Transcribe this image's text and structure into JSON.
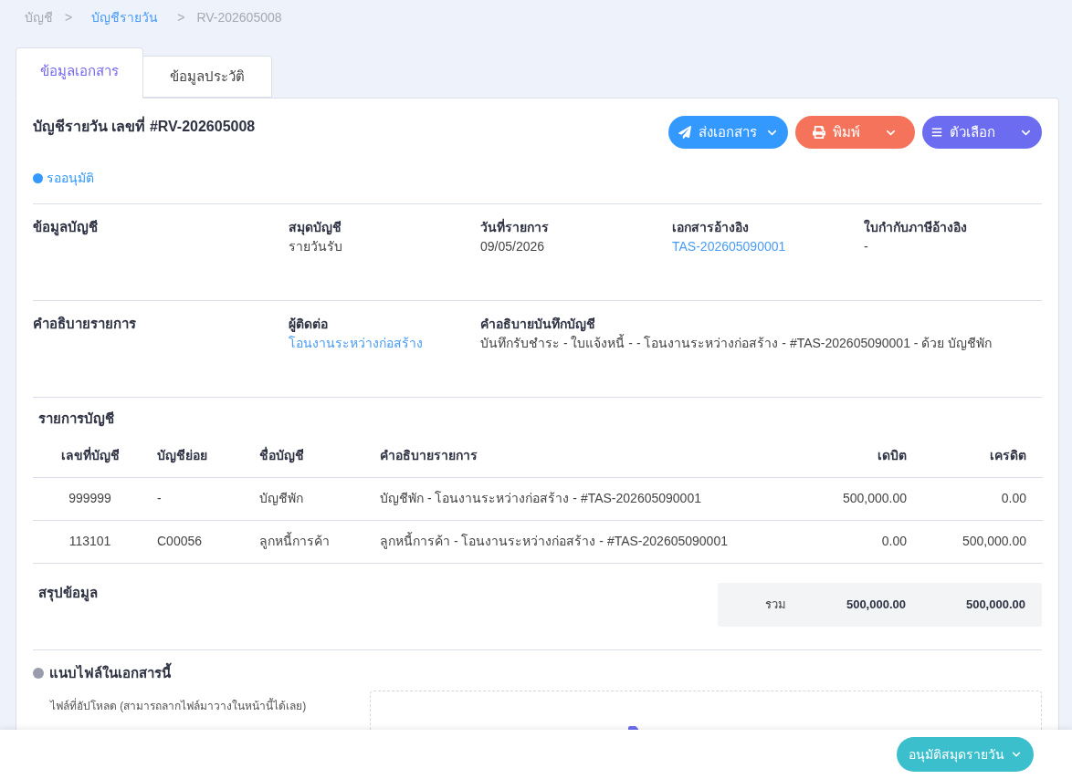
{
  "breadcrumb": [
    {
      "label": "บัญชี",
      "link": false
    },
    {
      "separator": ">",
      "label": "บัญชีรายวัน",
      "link": true
    },
    {
      "separator": ">",
      "label": "RV-202605008",
      "link": false
    }
  ],
  "tabs": [
    {
      "label": "ข้อมูลเอกสาร",
      "selected": true
    },
    {
      "label": "ข้อมูลประวัติ",
      "selected": false
    }
  ],
  "document": {
    "title": "บัญชีรายวัน เลขที่ #RV-202605008",
    "status": "รออนุมัติ"
  },
  "actions": [
    {
      "kind": "send",
      "label": "ส่งเอกสาร"
    },
    {
      "kind": "print",
      "label": "พิมพ์"
    },
    {
      "kind": "options",
      "label": "ตัวเลือก"
    }
  ],
  "sections": [
    {
      "title": "ข้อมูลบัญชี",
      "fields": [
        {
          "label": "สมุดบัญชี",
          "value": "รายวันรับ",
          "link": false
        },
        {
          "label": "วันที่รายการ",
          "value": "09/05/2026",
          "link": false
        },
        {
          "label": "เอกสารอ้างอิง",
          "value": "TAS-202605090001",
          "link": true
        },
        {
          "label": "ใบกำกับภาษีอ้างอิง",
          "value": "-",
          "link": false
        }
      ]
    },
    {
      "title": "คำอธิบายรายการ",
      "fields": [
        {
          "label": "ผู้ติดต่อ",
          "value": "โอนงานระหว่างก่อสร้าง",
          "link": true
        },
        {
          "label": "คำอธิบายบันทึกบัญชี",
          "value": "บันทึกรับชำระ - ใบแจ้งหนี้ - - โอนงานระหว่างก่อสร้าง - #TAS-202605090001 - ด้วย บัญชีพัก",
          "link": false
        }
      ]
    }
  ],
  "ledger": {
    "title": "รายการบัญชี",
    "columns": [
      "เลขที่บัญชี",
      "บัญชีย่อย",
      "ชื่อบัญชี",
      "คำอธิบายรายการ",
      "เดบิต",
      "เครดิต"
    ],
    "rows": [
      [
        "999999",
        "-",
        "บัญชีพัก",
        "บัญชีพัก - โอนงานระหว่างก่อสร้าง - #TAS-202605090001",
        "500,000.00",
        "0.00"
      ],
      [
        "113101",
        "C00056",
        "ลูกหนี้การค้า",
        "ลูกหนี้การค้า - โอนงานระหว่างก่อสร้าง - #TAS-202605090001",
        "0.00",
        "500,000.00"
      ]
    ]
  },
  "summary": {
    "title": "สรุปข้อมูล",
    "label": "รวม",
    "debit": "500,000.00",
    "credit": "500,000.00"
  },
  "attachments": {
    "title": "แนบไฟล์ในเอกสารนี้",
    "hint": "ไฟล์ที่อัปโหลด (สามารถลากไฟล์มาวางในหน้านี้ได้เลย)"
  },
  "footer": {
    "approve_button": "อนุมัติสมุดรายวัน"
  }
}
